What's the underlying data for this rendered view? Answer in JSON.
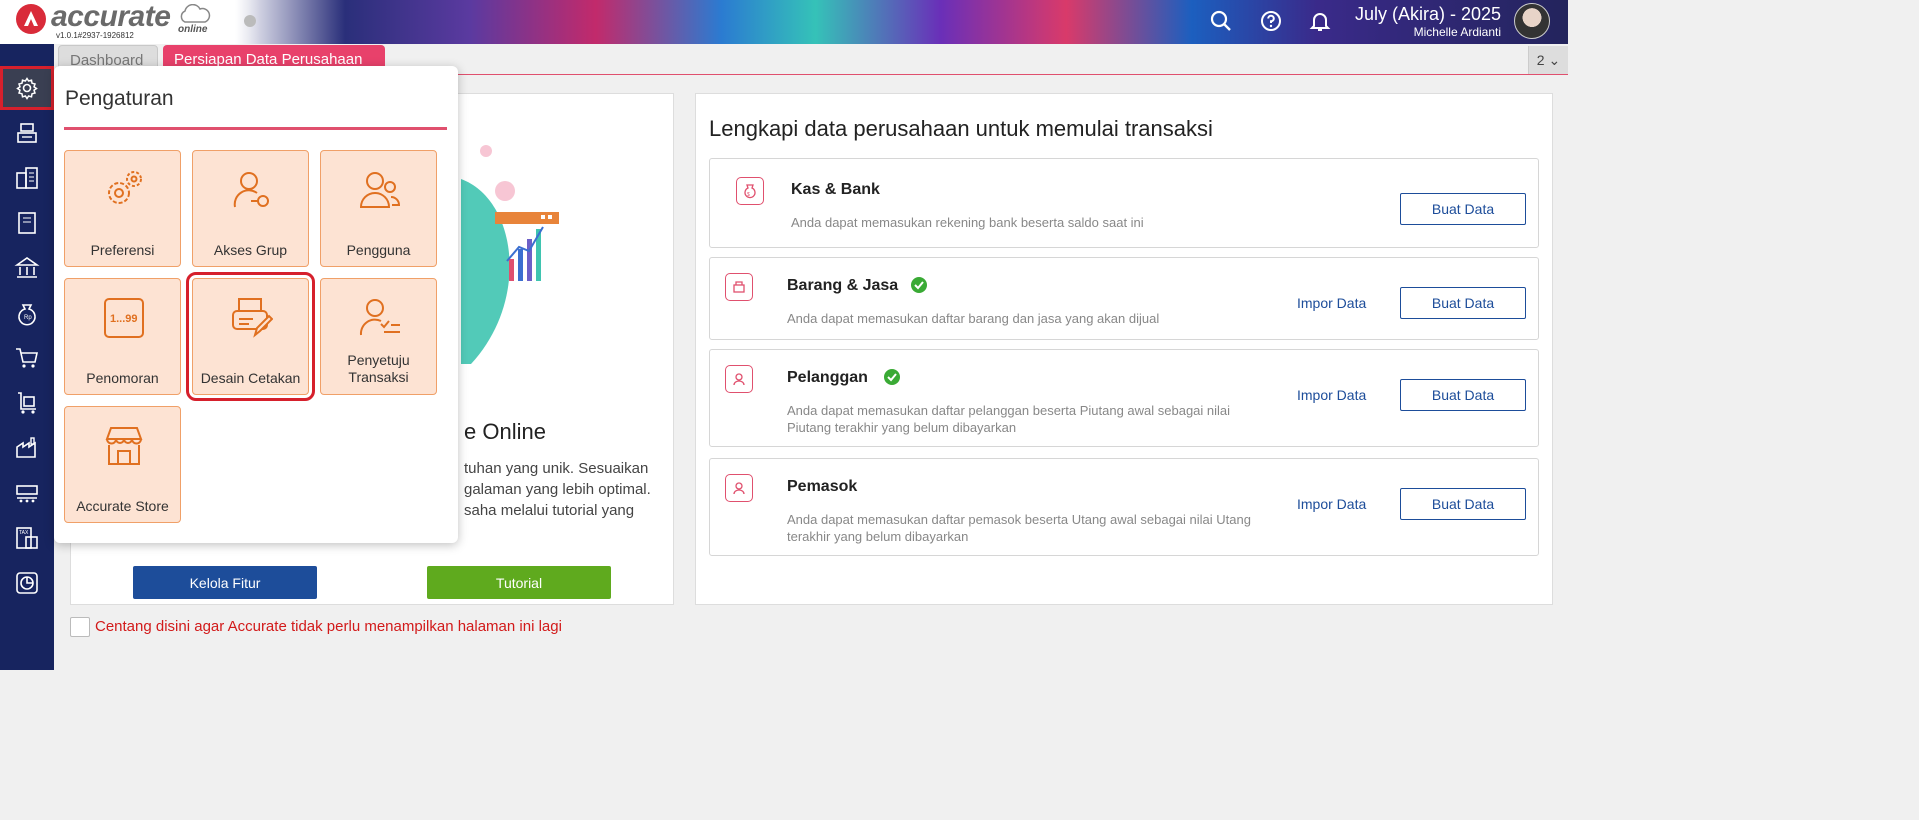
{
  "header": {
    "logo_text": "accurate",
    "logo_sub": "online",
    "version": "v1.0.1#2937-1926812",
    "period": "July (Akira) - 2025",
    "user": "Michelle Ardianti"
  },
  "tabs": {
    "dashboard": "Dashboard",
    "active": "Persiapan Data Perusahaan",
    "count": "2 ⌄"
  },
  "popup": {
    "title": "Pengaturan",
    "tiles": [
      {
        "label": "Preferensi",
        "icon": "gears-icon"
      },
      {
        "label": "Akses Grup",
        "icon": "user-key-icon"
      },
      {
        "label": "Pengguna",
        "icon": "users-icon"
      },
      {
        "label": "Penomoran",
        "icon": "numbering-icon",
        "icon_text": "1...99"
      },
      {
        "label": "Desain Cetakan",
        "icon": "printer-pencil-icon"
      },
      {
        "label": "Penyetuju Transaksi",
        "icon": "user-checklist-icon"
      },
      {
        "label": "Accurate Store",
        "icon": "store-icon"
      }
    ]
  },
  "left_panel": {
    "title_fragment": "e Online",
    "text_fragment": "tuhan yang unik. Sesuaikan galaman yang lebih optimal. saha melalui tutorial yang",
    "kelola_button": "Kelola Fitur",
    "tutorial_button": "Tutorial"
  },
  "right_panel": {
    "title": "Lengkapi data perusahaan untuk memulai transaksi",
    "cards": [
      {
        "title": "Kas & Bank",
        "desc": "Anda dapat memasukan rekening bank beserta saldo saat ini",
        "buat": "Buat Data",
        "checked": false
      },
      {
        "title": "Barang & Jasa",
        "desc": "Anda dapat memasukan daftar barang dan jasa yang akan dijual",
        "impor": "Impor Data",
        "buat": "Buat Data",
        "checked": true
      },
      {
        "title": "Pelanggan",
        "desc": "Anda dapat memasukan daftar pelanggan beserta Piutang awal sebagai nilai Piutang terakhir yang belum dibayarkan",
        "impor": "Impor Data",
        "buat": "Buat Data",
        "checked": true
      },
      {
        "title": "Pemasok",
        "desc": "Anda dapat memasukan daftar pemasok beserta Utang awal sebagai nilai Utang terakhir yang belum dibayarkan",
        "impor": "Impor Data",
        "buat": "Buat Data",
        "checked": false
      }
    ]
  },
  "footer": {
    "checkbox_label": "Centang disini agar Accurate tidak perlu menampilkan halaman ini lagi"
  },
  "colors": {
    "accent": "#e0506e",
    "sidebar": "#17245f",
    "tile_bg": "#fde3d3",
    "tile_icon": "#e07020",
    "primary_blue": "#1d4d9a",
    "green": "#5faa1e"
  }
}
